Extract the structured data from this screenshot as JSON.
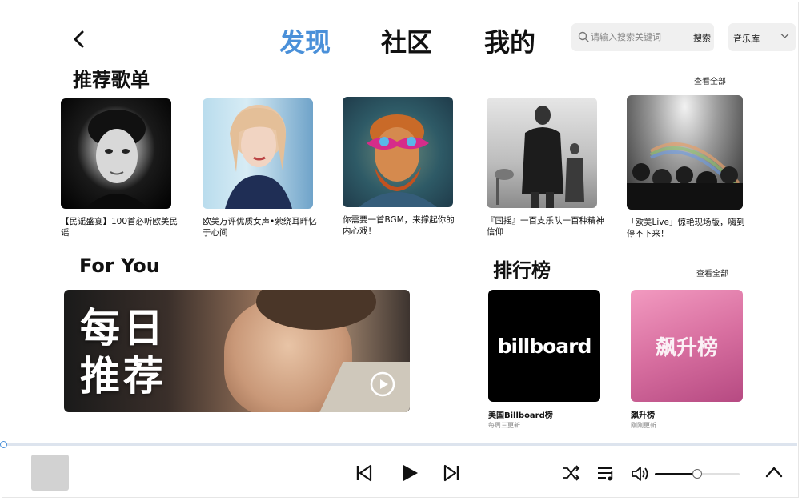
{
  "nav": {
    "tabs": [
      {
        "label": "发现",
        "active": true
      },
      {
        "label": "社区",
        "active": false
      },
      {
        "label": "我的",
        "active": false
      }
    ]
  },
  "search": {
    "placeholder": "请输入搜索关键词",
    "button_label": "搜索"
  },
  "library": {
    "label": "音乐库"
  },
  "recommended": {
    "title": "推荐歌单",
    "see_all": "查看全部",
    "playlists": [
      {
        "caption": "【民谣盛宴】100首必听欧美民谣"
      },
      {
        "caption": "欧美万评优质女声•萦绕耳畔忆于心间"
      },
      {
        "caption": "你需要一首BGM，来撑起你的内心戏！"
      },
      {
        "caption": "『国摇』一百支乐队一百种精神信仰"
      },
      {
        "caption": "「欧美Live」惊艳现场版，嗨到停不下来！"
      }
    ]
  },
  "foryou": {
    "title": "For You",
    "banner_text": "每日推荐"
  },
  "charts": {
    "title": "排行榜",
    "see_all": "查看全部",
    "items": [
      {
        "cover_text": "billboard",
        "name": "美国Billboard榜",
        "update": "每周三更新"
      },
      {
        "cover_text": "飙升榜",
        "name": "飙升榜",
        "update": "刚刚更新"
      }
    ]
  },
  "player": {
    "progress": 0,
    "volume": 0.5
  },
  "colors": {
    "accent": "#4a90d9",
    "rising_chart_start": "#f29ac0",
    "rising_chart_end": "#b64a82"
  }
}
